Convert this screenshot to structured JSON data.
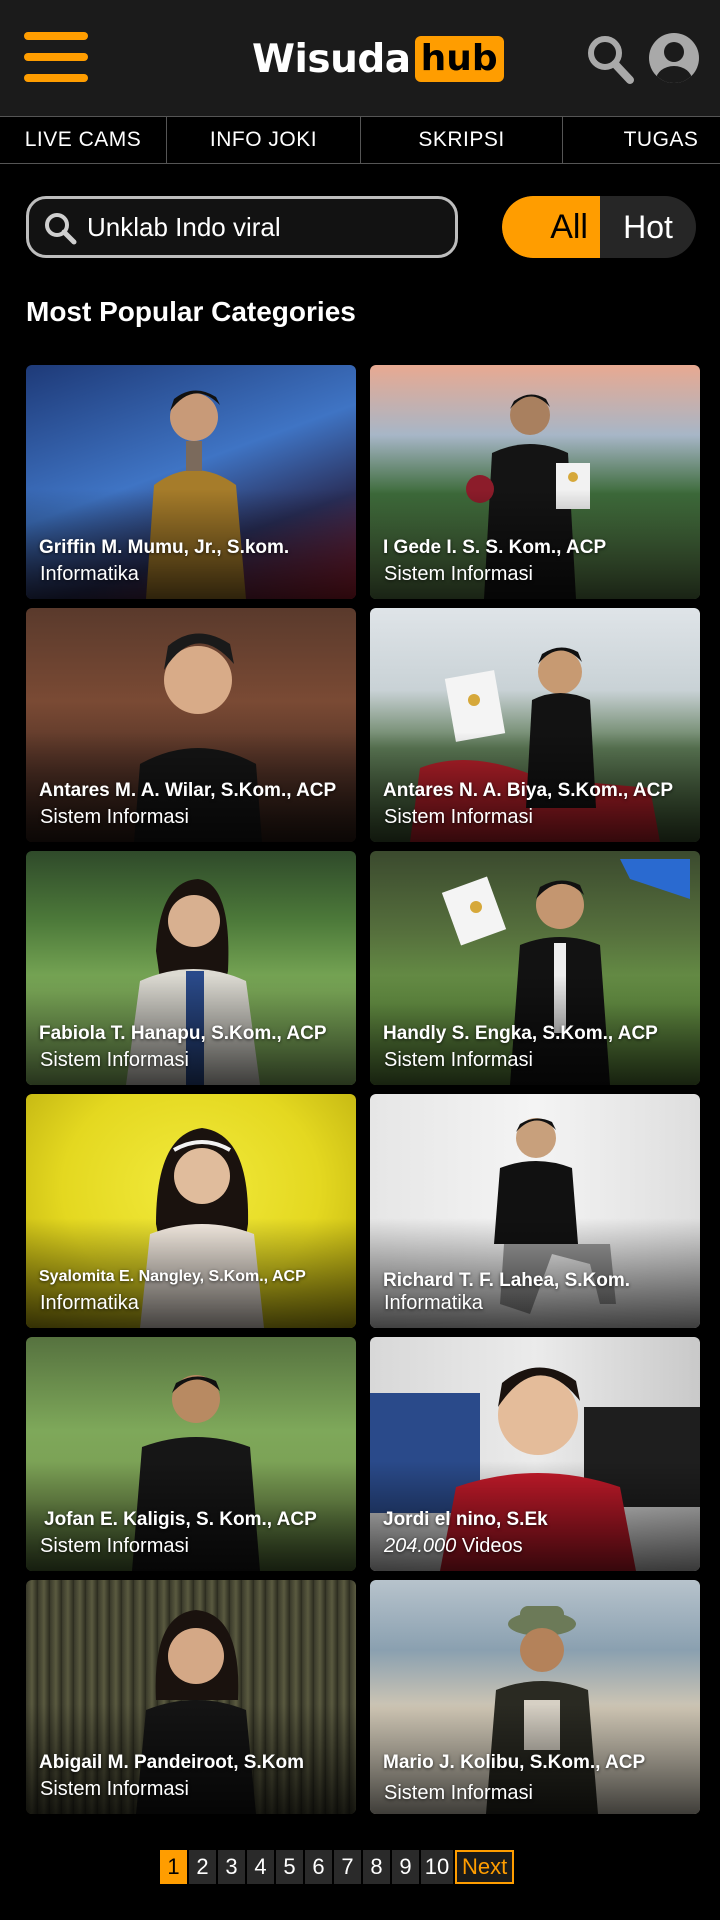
{
  "header": {
    "logo_part1": "Wisuda",
    "logo_part2": "hub",
    "icons": [
      "menu-icon",
      "search-icon",
      "user-icon"
    ],
    "accent": "#ff9d00"
  },
  "nav": {
    "tabs": [
      {
        "label": "LIVE CAMS"
      },
      {
        "label": "INFO JOKI"
      },
      {
        "label": "SKRIPSI"
      },
      {
        "label": "TUGAS"
      }
    ]
  },
  "search": {
    "value": "Unklab Indo viral",
    "placeholder": ""
  },
  "filter": {
    "options": [
      "All",
      "Hot"
    ],
    "selected": "All"
  },
  "section": {
    "title": "Most Popular Categories"
  },
  "cards": [
    {
      "name": "Griffin M. Mumu, Jr., S.kom.",
      "sub": "Informatika"
    },
    {
      "name": "I Gede I. S. S. Kom., ACP",
      "sub": "Sistem Informasi"
    },
    {
      "name": "Antares M. A. Wilar, S.Kom., ACP",
      "sub": "Sistem Informasi"
    },
    {
      "name": "Antares N. A. Biya, S.Kom., ACP",
      "sub": "Sistem Informasi"
    },
    {
      "name": "Fabiola T. Hanapu, S.Kom., ACP",
      "sub": "Sistem Informasi"
    },
    {
      "name": "Handly S. Engka, S.Kom., ACP",
      "sub": "Sistem Informasi"
    },
    {
      "name": "Syalomita E. Nangley, S.Kom., ACP",
      "sub": "Informatika"
    },
    {
      "name": "Richard T. F. Lahea, S.Kom.",
      "sub": "Informatika"
    },
    {
      "name": "Jofan E. Kaligis, S. Kom., ACP",
      "sub": "Sistem Informasi"
    },
    {
      "name": "Jordi el nino, S.Ek",
      "sub_count": "204.000",
      "sub_suffix": " Videos"
    },
    {
      "name": "Abigail M. Pandeiroot, S.Kom",
      "sub": "Sistem Informasi"
    },
    {
      "name": "Mario J. Kolibu, S.Kom., ACP",
      "sub": "Sistem Informasi"
    }
  ],
  "pagination": {
    "pages": [
      "1",
      "2",
      "3",
      "4",
      "5",
      "6",
      "7",
      "8",
      "9",
      "10"
    ],
    "current": "1",
    "next_label": "Next"
  }
}
